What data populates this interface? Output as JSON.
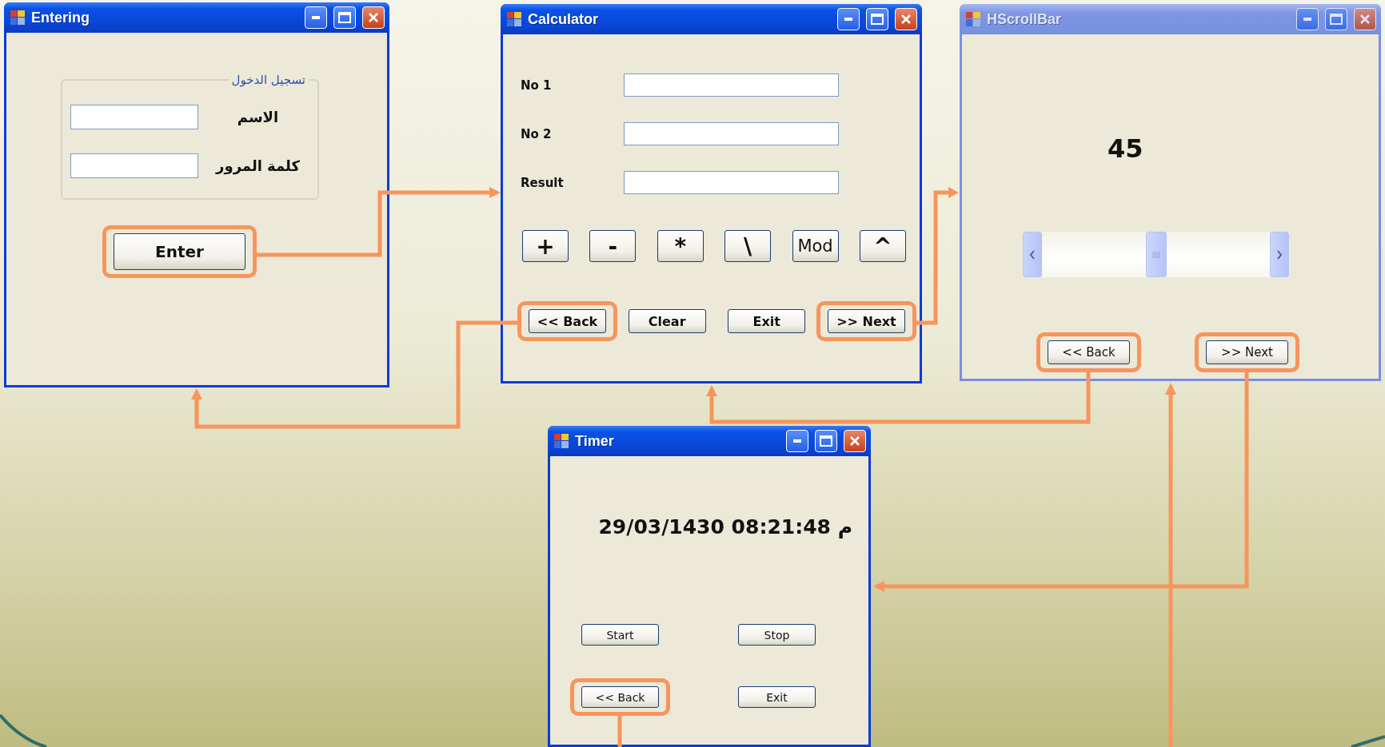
{
  "windows": [
    {
      "kind": "login",
      "title": "Entering",
      "active": true,
      "group_title": "تسجيل الدخول",
      "fields": [
        {
          "label": "الاسم"
        },
        {
          "label": "كلمة المرور"
        }
      ],
      "buttons": [
        {
          "label": "Enter",
          "highlighted": true
        }
      ]
    },
    {
      "kind": "calculator",
      "title": "Calculator",
      "active": true,
      "fields": [
        {
          "label": "No 1"
        },
        {
          "label": "No 2"
        },
        {
          "label": "Result"
        }
      ],
      "operators": [
        {
          "label": "+",
          "kind": "symbol"
        },
        {
          "label": "-",
          "kind": "symbol"
        },
        {
          "label": "*",
          "kind": "symbol"
        },
        {
          "label": "\\",
          "kind": "symbol"
        },
        {
          "label": "Mod",
          "kind": "word"
        },
        {
          "label": "^",
          "kind": "symbol"
        }
      ],
      "buttons": [
        {
          "label": "<< Back",
          "highlighted": true
        },
        {
          "label": "Clear",
          "highlighted": false
        },
        {
          "label": "Exit",
          "highlighted": false
        },
        {
          "label": ">> Next",
          "highlighted": true
        }
      ]
    },
    {
      "kind": "scrollbar",
      "title": "HScrollBar",
      "active": false,
      "value": "45",
      "scrollbar": {
        "level": 0.5
      },
      "buttons": [
        {
          "label": "<< Back",
          "highlighted": true
        },
        {
          "label": ">> Next",
          "highlighted": true
        }
      ]
    },
    {
      "kind": "timer",
      "title": "Timer",
      "active": true,
      "clock": "29/03/1430 08:21:48 م",
      "buttons": [
        {
          "label": "Start",
          "highlighted": false
        },
        {
          "label": "Stop",
          "highlighted": false
        },
        {
          "label": "<< Back",
          "highlighted": true
        },
        {
          "label": "Exit",
          "highlighted": false
        }
      ]
    }
  ]
}
